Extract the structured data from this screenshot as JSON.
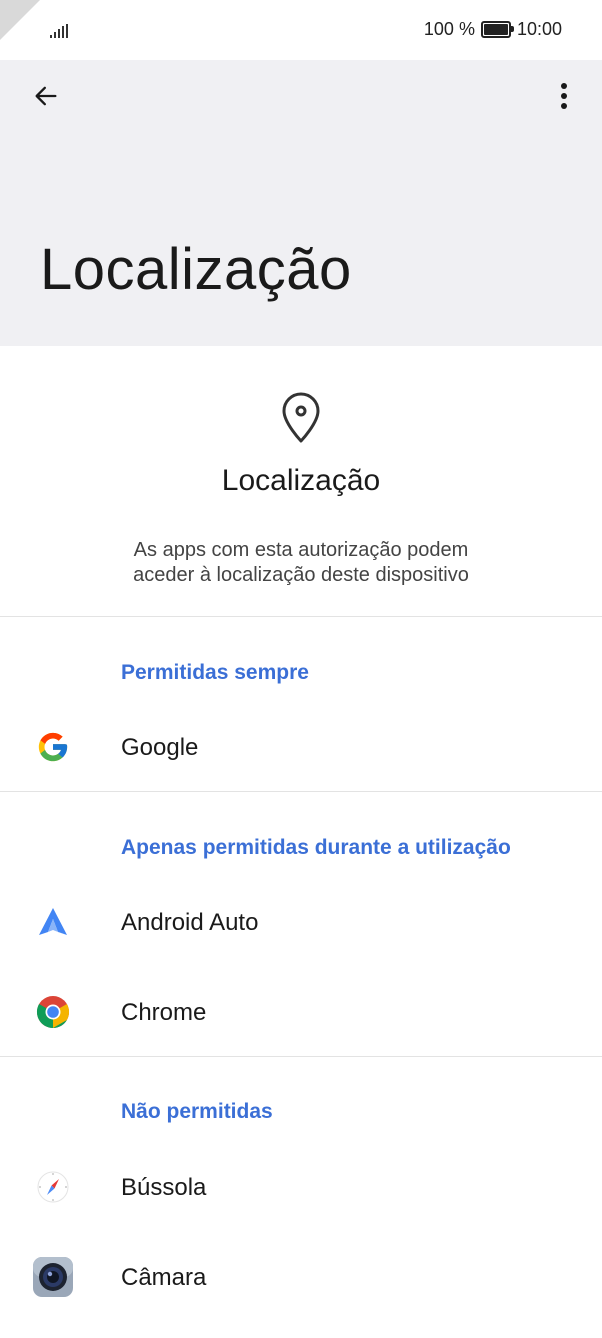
{
  "status_bar": {
    "battery_text": "100 %",
    "time": "10:00"
  },
  "app_bar": {
    "title": "Localização"
  },
  "header": {
    "title": "Localização",
    "description_line1": "As apps com esta autorização podem",
    "description_line2": "aceder à localização deste dispositivo"
  },
  "sections": [
    {
      "label": "Permitidas sempre",
      "apps": [
        {
          "name": "Google",
          "icon": "google-icon"
        }
      ]
    },
    {
      "label": "Apenas permitidas durante a utilização",
      "apps": [
        {
          "name": "Android Auto",
          "icon": "android-auto-icon"
        },
        {
          "name": "Chrome",
          "icon": "chrome-icon"
        }
      ]
    },
    {
      "label": "Não permitidas",
      "apps": [
        {
          "name": "Bússola",
          "icon": "compass-icon"
        },
        {
          "name": "Câmara",
          "icon": "camera-icon"
        }
      ]
    }
  ],
  "colors": {
    "accent": "#3b6fd6",
    "app_bar_bg": "#f0f0f3"
  }
}
